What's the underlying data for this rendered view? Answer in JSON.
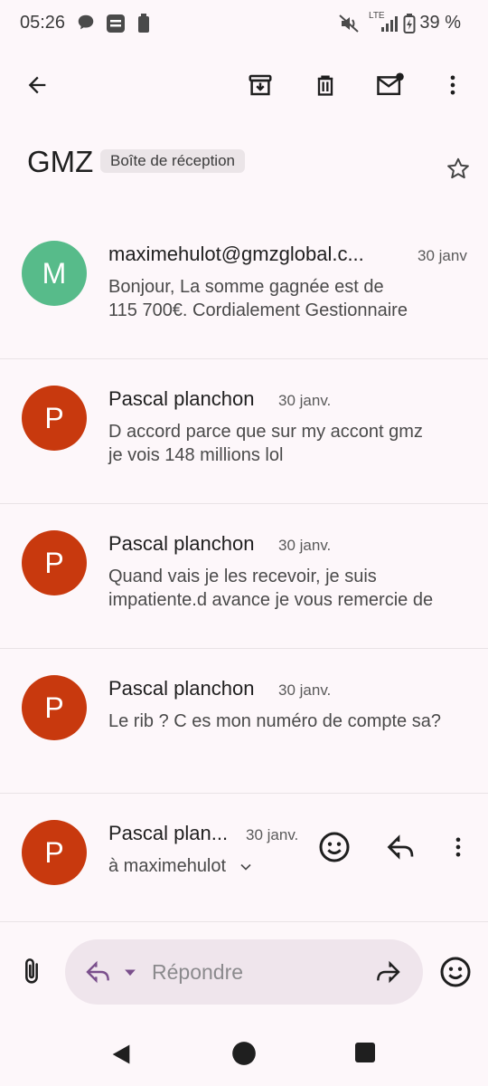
{
  "status_bar": {
    "time": "05:26",
    "network": "LTE",
    "battery_percent": "39 %",
    "icons": [
      "message-icon",
      "app-icon",
      "battery-small-icon",
      "mute-icon",
      "signal-icon",
      "battery-icon"
    ]
  },
  "toolbar": {
    "icons": [
      "back-arrow-icon",
      "archive-icon",
      "delete-icon",
      "mark-unread-icon",
      "more-vert-icon"
    ]
  },
  "thread": {
    "subject": "GMZ",
    "label": "Boîte de réception"
  },
  "messages": [
    {
      "avatar_letter": "M",
      "avatar_color": "#57bb8a",
      "sender": "maximehulot@gmzglobal.c...",
      "date": "30 janv",
      "snippet_line1": "Bonjour, La somme gagnée est de",
      "snippet_line2": "115 700€. Cordialement Gestionnaire"
    },
    {
      "avatar_letter": "P",
      "avatar_color": "#c8390e",
      "sender": "Pascal planchon",
      "date": "30 janv.",
      "snippet_line1": "D accord parce que sur my accont gmz",
      "snippet_line2": "je vois 148 millions lol"
    },
    {
      "avatar_letter": "P",
      "avatar_color": "#c8390e",
      "sender": "Pascal planchon",
      "date": "30 janv.",
      "snippet_line1": "Quand vais je les recevoir, je suis",
      "snippet_line2": "impatiente.d avance je vous remercie de"
    },
    {
      "avatar_letter": "P",
      "avatar_color": "#c8390e",
      "sender": "Pascal planchon",
      "date": "30 janv.",
      "snippet_line1": "Le rib ? C es mon numéro de compte sa?",
      "snippet_line2": ""
    }
  ],
  "expanded_message": {
    "avatar_letter": "P",
    "avatar_color": "#c8390e",
    "sender": "Pascal plan...",
    "date": "30 janv.",
    "recipient": "à maximehulot"
  },
  "reply_bar": {
    "placeholder": "Répondre"
  },
  "colors": {
    "background": "#fdf7fa",
    "pill": "#efe5ec",
    "reply_accent": "#7a4f8c"
  }
}
